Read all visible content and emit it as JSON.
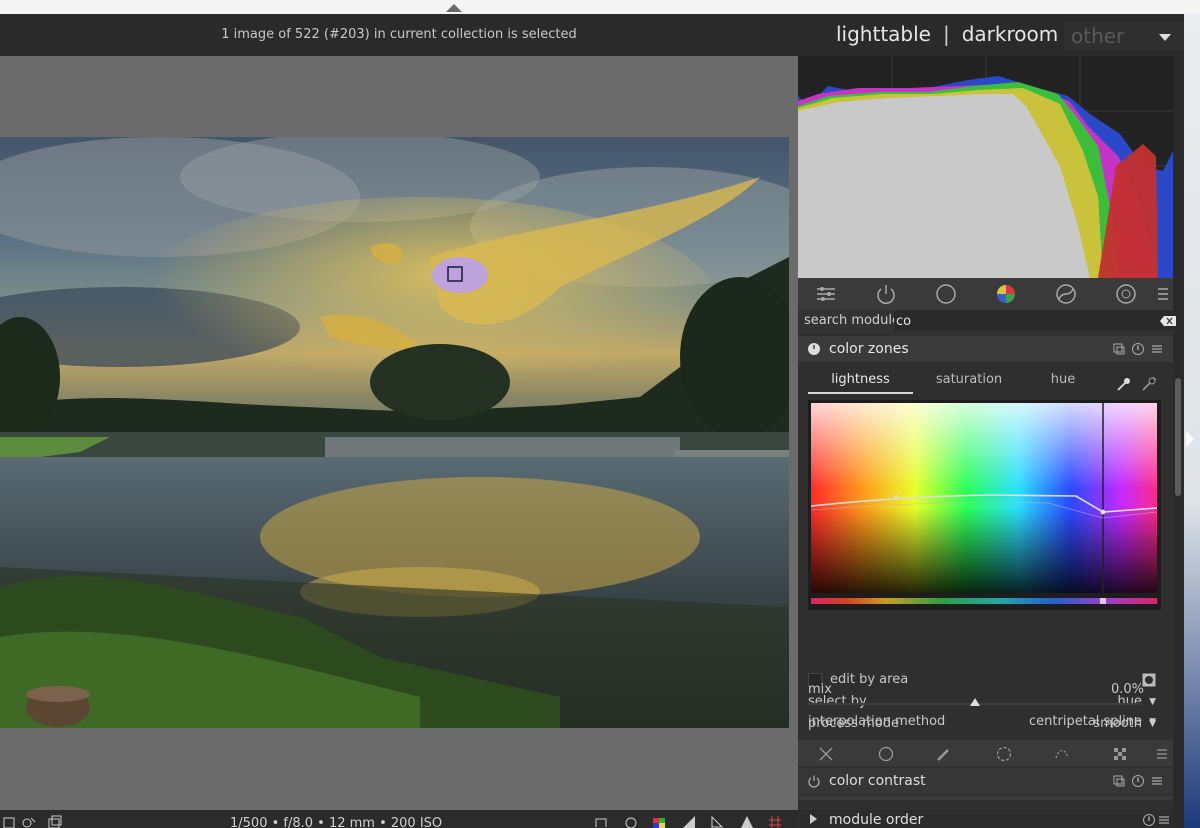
{
  "header": {
    "info": "1 image of 522 (#203) in current collection is selected",
    "views": [
      "lighttable",
      "darkroom"
    ],
    "separator": "|",
    "other_label": "other"
  },
  "bottom": {
    "exif": "1/500 • f/8.0 • 12 mm • 200 ISO"
  },
  "panel": {
    "search": {
      "label": "search module",
      "value": "co"
    },
    "color_zones": {
      "title": "color zones",
      "tabs": [
        "lightness",
        "saturation",
        "hue"
      ],
      "active_tab": "lightness",
      "edit_by_area_label": "edit by area",
      "select_by": {
        "label": "select by",
        "value": "hue"
      },
      "process_mode": {
        "label": "process mode",
        "value": "smooth"
      },
      "mix": {
        "label": "mix",
        "value": "0.0%",
        "level": 0.5
      },
      "interpolation": {
        "label": "interpolation method",
        "value": "centripetal spline"
      }
    },
    "color_contrast": {
      "title": "color contrast"
    },
    "module_order": {
      "title": "module order"
    }
  },
  "icons": {
    "module_groups": [
      "sliders-icon",
      "power-icon",
      "circle-icon",
      "color-ball-icon",
      "correct-icon",
      "effect-icon",
      "hamburger-icon"
    ],
    "masks": [
      "close-icon",
      "circle-icon",
      "brush-icon",
      "gradient-icon",
      "path-icon",
      "checkerboard-icon",
      "hamburger-icon"
    ]
  },
  "colors": {
    "panel_bg": "#303030",
    "header_bg": "#2a2a2a",
    "center_bg": "#6b6b6b",
    "histogram_gray": "#c9c9c9"
  }
}
